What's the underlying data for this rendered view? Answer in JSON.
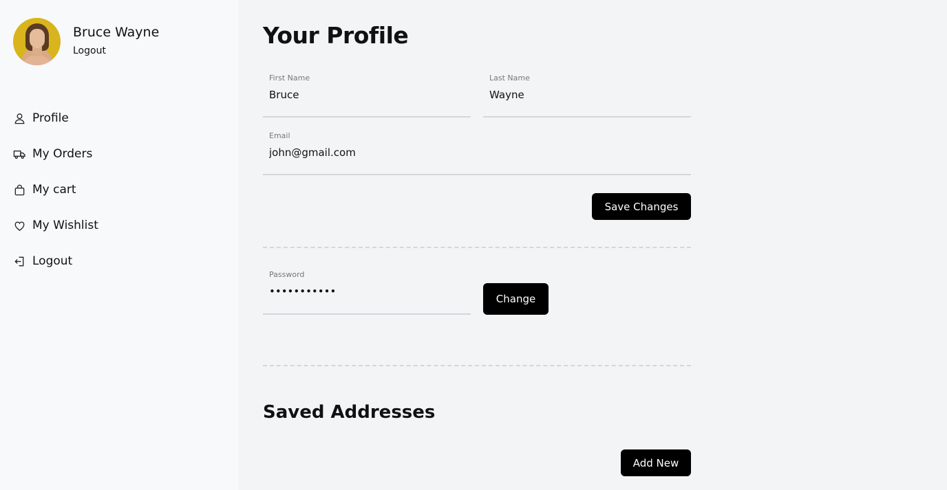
{
  "user": {
    "name": "Bruce Wayne",
    "logout_label": "Logout"
  },
  "sidebar": {
    "items": [
      {
        "label": "Profile",
        "icon": "user-icon"
      },
      {
        "label": "My Orders",
        "icon": "truck-icon"
      },
      {
        "label": "My cart",
        "icon": "shopping-bag-icon"
      },
      {
        "label": "My Wishlist",
        "icon": "heart-icon"
      },
      {
        "label": "Logout",
        "icon": "logout-icon"
      }
    ]
  },
  "main": {
    "title": "Your Profile",
    "first_name": {
      "label": "First Name",
      "value": "Bruce"
    },
    "last_name": {
      "label": "Last Name",
      "value": "Wayne"
    },
    "email": {
      "label": "Email",
      "value": "john@gmail.com"
    },
    "save_label": "Save Changes",
    "password": {
      "label": "Password",
      "value": "•••••••••••"
    },
    "change_label": "Change",
    "addresses_title": "Saved Addresses",
    "add_new_label": "Add New"
  }
}
